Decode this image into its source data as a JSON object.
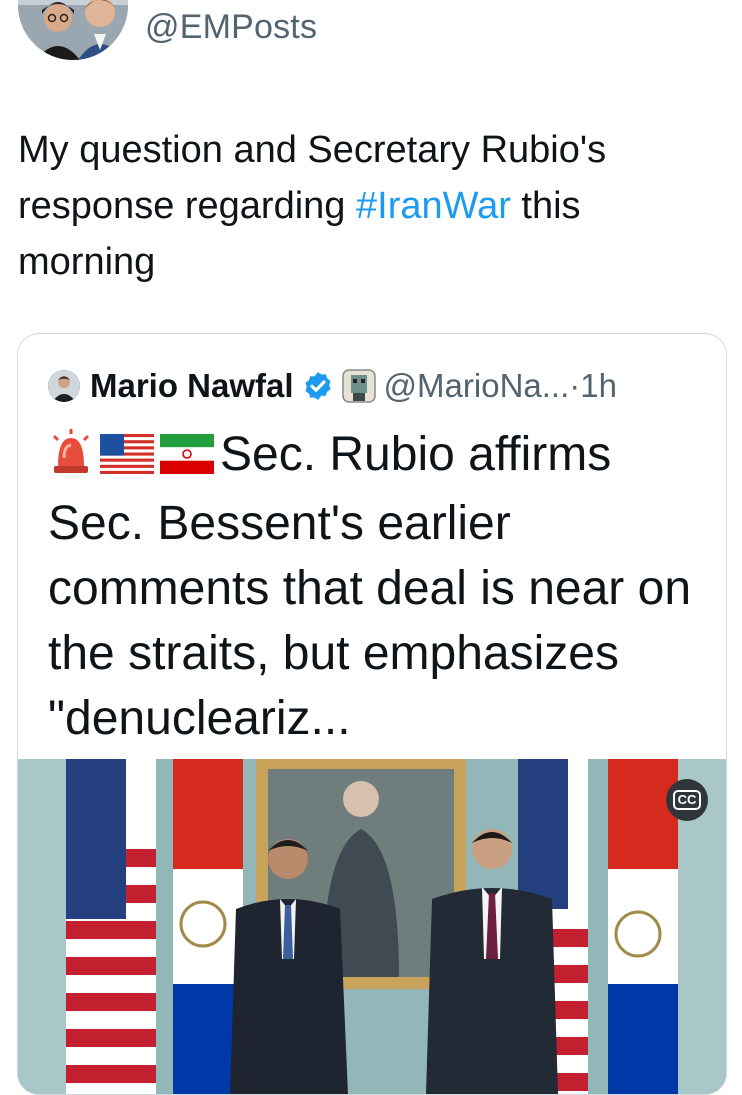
{
  "tweet": {
    "handle": "@EMPosts",
    "text_before": "My question and Secretary Rubio's response regarding ",
    "hashtag": "#IranWar",
    "text_after": " this morning"
  },
  "quote": {
    "author_name": "Mario Nawfal",
    "handle_time": "@MarioNa...·1h",
    "body_text": "Sec. Rubio affirms Sec. Bessent's earlier comments that deal is near on the straits, but emphasizes \"denucleariz...",
    "emoji_icons": [
      "rotating-light-icon",
      "us-flag-icon",
      "iran-flag-icon"
    ]
  },
  "media": {
    "cc_label": "CC"
  },
  "colors": {
    "link": "#1d9bf0",
    "secondary_text": "#536471",
    "verified": "#1d9bf0",
    "border": "#cfd9de"
  }
}
